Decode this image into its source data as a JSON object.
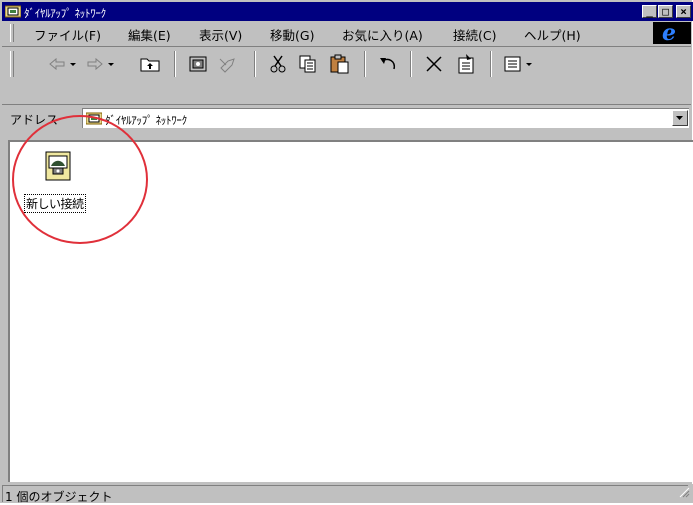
{
  "window": {
    "title": "ﾀﾞｲﾔﾙｱｯﾌﾟ ﾈｯﾄﾜｰｸ",
    "minimize_glyph": "_",
    "maximize_glyph": "□",
    "close_glyph": "×"
  },
  "menu": {
    "items": [
      {
        "label": "ファイル(F)"
      },
      {
        "label": "編集(E)"
      },
      {
        "label": "表示(V)"
      },
      {
        "label": "移動(G)"
      },
      {
        "label": "お気に入り(A)"
      },
      {
        "label": "接続(C)"
      },
      {
        "label": "ヘルプ(H)"
      }
    ],
    "ie_logo": "e"
  },
  "toolbar": {
    "buttons": [
      "back-icon",
      "forward-icon",
      "up-folder-icon",
      "map-drive-icon",
      "disconnect-icon",
      "cut-icon",
      "copy-icon",
      "paste-icon",
      "undo-icon",
      "delete-icon",
      "properties-icon",
      "views-icon"
    ]
  },
  "address": {
    "label": "アドレス",
    "value": "ﾀﾞｲﾔﾙｱｯﾌﾟ ﾈｯﾄﾜｰｸ"
  },
  "content": {
    "items": [
      {
        "label": "新しい接続",
        "icon": "new-connection-icon"
      }
    ],
    "highlight_color": "#e0303a"
  },
  "status": {
    "text": "1 個のオブジェクト"
  },
  "colors": {
    "titlebar": "#000080",
    "face": "#c0c0c0"
  }
}
